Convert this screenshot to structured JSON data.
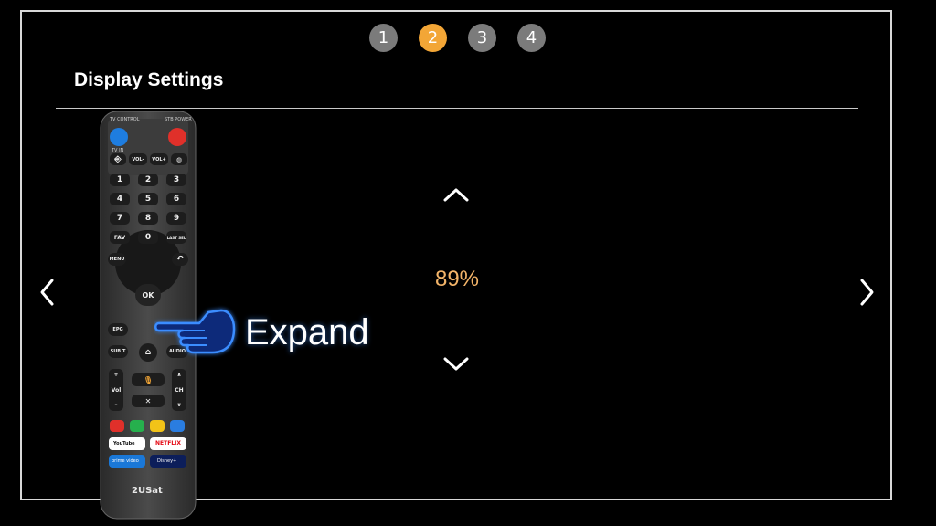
{
  "pager": {
    "steps": [
      {
        "label": "1",
        "active": false
      },
      {
        "label": "2",
        "active": true
      },
      {
        "label": "3",
        "active": false
      },
      {
        "label": "4",
        "active": false
      }
    ]
  },
  "screen": {
    "title": "Display Settings",
    "value": "89%"
  },
  "hint": {
    "label": "Expand"
  },
  "remote": {
    "tv_control": "TV CONTROL",
    "stb_power": "STB POWER",
    "tv_in": "TV IN",
    "vol_minus": "VOL-",
    "vol_plus": "VOL+",
    "digits": [
      "1",
      "2",
      "3",
      "4",
      "5",
      "6",
      "7",
      "8",
      "9"
    ],
    "fav": "FAV",
    "zero": "0",
    "last": "LAST SEL",
    "menu": "MENU",
    "ok": "OK",
    "epg": "EPG",
    "sub": "SUB.T",
    "audio": "AUDIO",
    "vol": "Vol",
    "ch": "CH",
    "youtube": "YouTube",
    "netflix": "NETFLIX",
    "prime": "prime video",
    "disney": "Disney+",
    "brand": "2USat"
  },
  "colors": {
    "accent": "#f3a636",
    "value_text": "#f3b469",
    "inactive_step": "#7b7b7b",
    "hand_glow": "#1e6cff"
  }
}
